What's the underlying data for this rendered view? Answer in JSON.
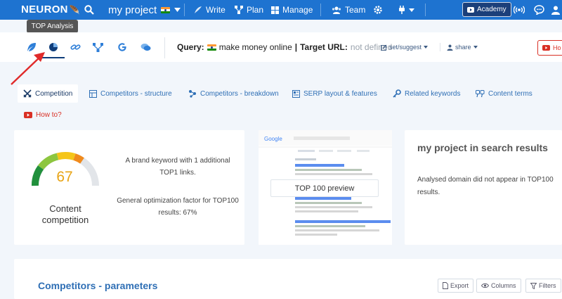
{
  "app": {
    "logo": "NEURON"
  },
  "nav": {
    "project": "my project",
    "write": "Write",
    "plan": "Plan",
    "manage": "Manage",
    "team": "Team",
    "academy": "Academy"
  },
  "tooltip": "TOP Analysis",
  "query": {
    "label": "Query:",
    "value": "make money online",
    "separator": "|",
    "target_label": "Target URL:",
    "target_value": "not defined",
    "set_suggest": "set/suggest",
    "share": "share",
    "youtube_label": "Ho"
  },
  "tabs": [
    {
      "label": "Competition",
      "icon": "swords-icon"
    },
    {
      "label": "Competitors - structure",
      "icon": "structure-icon"
    },
    {
      "label": "Competitors - breakdown",
      "icon": "breakdown-icon"
    },
    {
      "label": "SERP layout & features",
      "icon": "serp-icon"
    },
    {
      "label": "Related keywords",
      "icon": "key-icon"
    },
    {
      "label": "Content terms",
      "icon": "quote-icon"
    }
  ],
  "how_to": "How to?",
  "competition": {
    "score": "67",
    "score_value": 67,
    "title_line1": "Content",
    "title_line2": "competition",
    "text1_line1": "A brand keyword with 1 additional",
    "text1_line2": "TOP1 links.",
    "text2_line1": "General optimization factor for TOP100",
    "text2_line2": "results: 67%"
  },
  "serp": {
    "button": "TOP 100 preview"
  },
  "project_results": {
    "title": "my project in search results",
    "text_line1": "Analysed domain did not appear in TOP100",
    "text_line2": "results."
  },
  "params": {
    "title": "Competitors - parameters",
    "export": "Export",
    "columns": "Columns",
    "filters": "Filters"
  },
  "colors": {
    "nav_blue": "#1e73d0",
    "link_blue": "#2f6fb5",
    "accent_orange": "#e8a416",
    "youtube_red": "#d93025"
  }
}
